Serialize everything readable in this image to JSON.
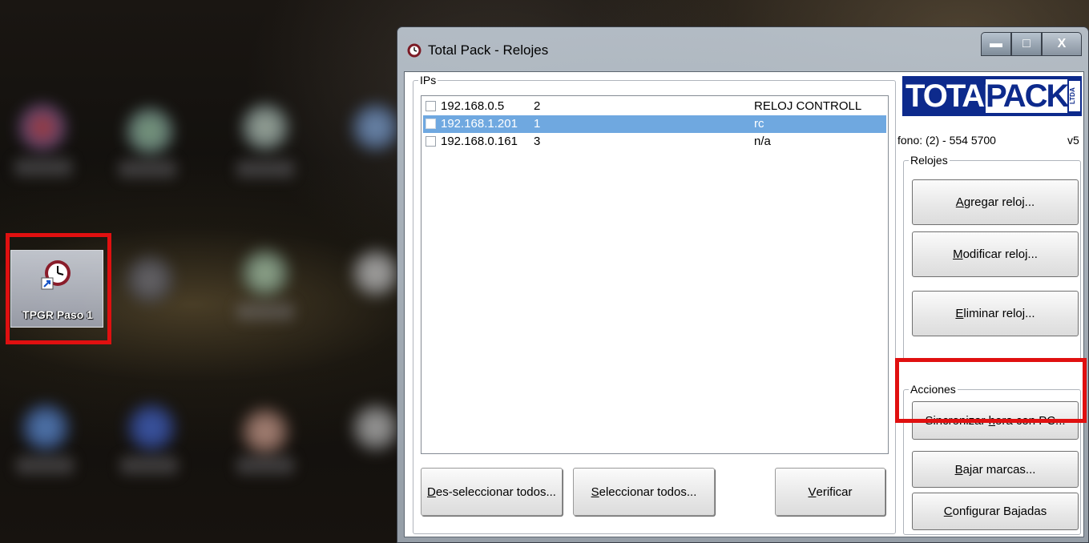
{
  "desktop": {
    "shortcut_label": "TPGR Paso 1",
    "shortcut_icon": "clock-shortcut-icon"
  },
  "window": {
    "title": "Total Pack - Relojes",
    "controls": {
      "minimize": "▬",
      "maximize": "□",
      "close": "X"
    },
    "ips_group_label": "IPs",
    "list": [
      {
        "ip": "192.168.0.5",
        "num": "2",
        "name": "RELOJ CONTROLL",
        "selected": false
      },
      {
        "ip": "192.168.1.201",
        "num": "1",
        "name": "rc",
        "selected": true
      },
      {
        "ip": "192.168.0.161",
        "num": "3",
        "name": "n/a",
        "selected": false
      }
    ],
    "buttons_bottom": {
      "deselect_prefix": "D",
      "deselect_rest": "es-seleccionar todos...",
      "select_prefix": "S",
      "select_rest": "eleccionar todos...",
      "verify_prefix": "V",
      "verify_rest": "erificar"
    },
    "logo": {
      "total": "TOTAL",
      "pack": "PACK",
      "ltda": "LTDA"
    },
    "phone": "fono: (2) - 554 5700",
    "version": "v5",
    "relojes": {
      "label": "Relojes",
      "add_prefix": "A",
      "add_rest": "gregar reloj...",
      "modify_prefix": "M",
      "modify_rest": "odificar reloj...",
      "delete_prefix": "E",
      "delete_rest": "liminar reloj..."
    },
    "acciones": {
      "label": "Acciones",
      "sync_before": "Sincronizar ",
      "sync_underline": "h",
      "sync_after": "ora con PC...",
      "download_prefix": "B",
      "download_rest": "ajar marcas...",
      "config_prefix": "C",
      "config_rest": "onfigurar Bajadas"
    }
  },
  "colors": {
    "selection": "#6fa8e0",
    "logo_blue": "#0d2a8c",
    "highlight_red": "#e01010"
  }
}
